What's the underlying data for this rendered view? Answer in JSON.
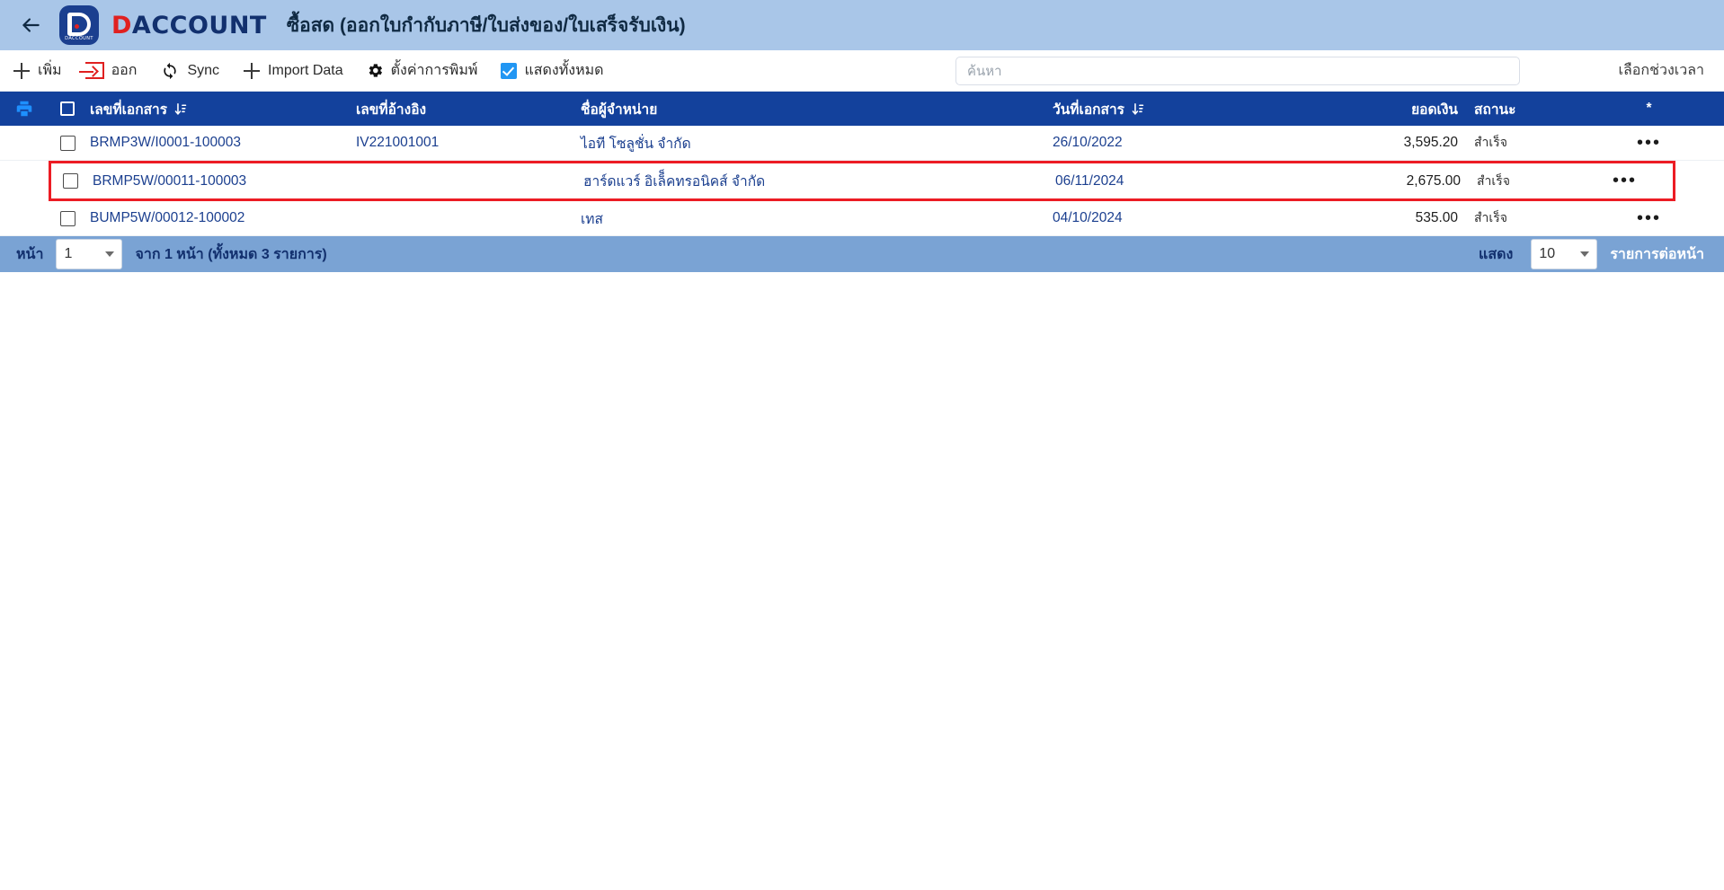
{
  "header": {
    "back_icon": "back-arrow-icon",
    "logo_sub": "DACCOUNT",
    "brand_first": "D",
    "brand_rest": "ACCOUNT",
    "title": "ซื้อสด (ออกใบกำกับภาษี/ใบส่งของ/ใบเสร็จรับเงิน)"
  },
  "toolbar": {
    "add_label": "เพิ่ม",
    "export_label": "ออก",
    "sync_label": "Sync",
    "import_label": "Import Data",
    "print_settings_label": "ตั้งค่าการพิมพ์",
    "show_all_label": "แสดงทั้งหมด",
    "show_all_checked": true,
    "search_placeholder": "ค้นหา",
    "search_value": "",
    "date_range_label": "เลือกช่วงเวลา"
  },
  "table": {
    "columns": {
      "print": "printer-icon",
      "select_all": "",
      "doc_no": "เลขที่เอกสาร",
      "ref_no": "เลขที่อ้างอิง",
      "vendor": "ชื่อผู้จำหน่าย",
      "doc_date": "วันที่เอกสาร",
      "amount": "ยอดเงิน",
      "status": "สถานะ",
      "action": "*"
    },
    "rows": [
      {
        "doc_no": "BRMP3W/I0001-100003",
        "ref_no": "IV221001001",
        "vendor": "ไอที โซลูชั่น จำกัด",
        "doc_date": "26/10/2022",
        "amount": "3,595.20",
        "status": "สำเร็จ",
        "action": "•••",
        "highlighted": false
      },
      {
        "doc_no": "BRMP5W/00011-100003",
        "ref_no": "",
        "vendor": "ฮาร์ดแวร์ อิเล็็คทรอนิคส์ จำกัด",
        "doc_date": "06/11/2024",
        "amount": "2,675.00",
        "status": "สำเร็จ",
        "action": "•••",
        "highlighted": true
      },
      {
        "doc_no": "BUMP5W/00012-100002",
        "ref_no": "",
        "vendor": "เทส",
        "doc_date": "04/10/2024",
        "amount": "535.00",
        "status": "สำเร็จ",
        "action": "•••",
        "highlighted": false
      }
    ]
  },
  "footer": {
    "page_label": "หน้า",
    "page_value": "1",
    "summary": "จาก 1 หน้า (ทั้งหมด 3 รายการ)",
    "show_label": "แสดง",
    "rows_value": "10",
    "rows_per_page_label": "รายการต่อหน้า"
  },
  "colors": {
    "topbar": "#a9c6e8",
    "table_header": "#13419c",
    "footer": "#7aa3d4",
    "highlight": "#ec1c24",
    "accent_blue": "#1b3f8f",
    "checkbox": "#2196f3"
  }
}
